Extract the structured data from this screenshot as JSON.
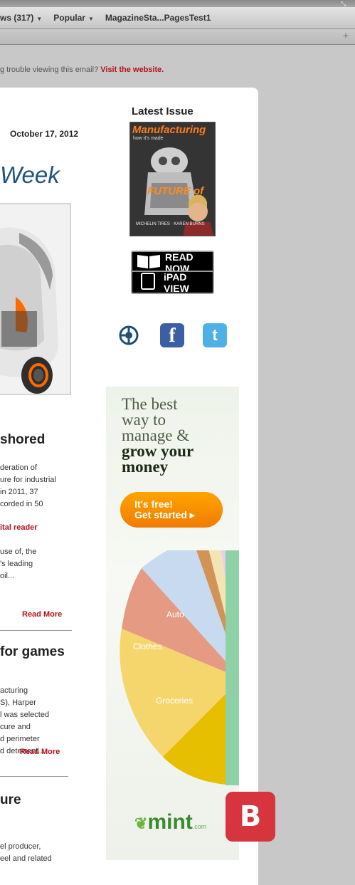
{
  "browser": {
    "bookmarks": [
      {
        "label": "ws (317)",
        "has_menu": true
      },
      {
        "label": "Popular",
        "has_menu": true
      },
      {
        "label": "MagazineSta...PagesTest1",
        "has_menu": false
      }
    ],
    "caret": "▼",
    "new_tab": "+"
  },
  "email": {
    "trouble_text": "g trouble viewing this email?",
    "trouble_link": "Visit the website.",
    "date": "October 17, 2012",
    "masthead_word": "Week",
    "articles": [
      {
        "headline": "shored",
        "lines": [
          "deration of",
          "ure for industrial",
          " in 2011, 37",
          "corded in 50"
        ],
        "related": "ital reader",
        "lines2": [
          "use of, the",
          "'s leading",
          "oil..."
        ],
        "read_more": "Read More"
      },
      {
        "headline": " for games",
        "lines": [
          "acturing",
          "S), Harper",
          "l was selected",
          "cure and",
          "d perimeter",
          "d deterrent..."
        ],
        "read_more": "Read More"
      },
      {
        "headline": "ure",
        "lines": [
          "el producer,",
          "eel and related"
        ]
      }
    ],
    "sidebar": {
      "latest_issue_title": "Latest Issue",
      "cover": {
        "brand": "Manufacturing",
        "tagline": "how it's made",
        "feature": "FUTURE of",
        "names": "MICHELIN TIRES · KAREN BURNS"
      },
      "read_now": "READ NOW",
      "ipad_view": "iPAD VIEW",
      "social_icons": [
        "rss-icon",
        "facebook-icon",
        "twitter-icon"
      ]
    },
    "ad": {
      "headline_lines": [
        "The best",
        "way to",
        "manage &",
        "grow your",
        "money"
      ],
      "cta_line1": "It's free!",
      "cta_line2": "Get started ▸",
      "pie_labels": [
        "Auto",
        "Clothes",
        "Groceries"
      ],
      "brand": "mint",
      "brand_suffix": ".com"
    },
    "badge": "B"
  },
  "colors": {
    "accent_red": "#b1121a",
    "title_blue": "#1d5480",
    "ad_orange": "#f08a00",
    "mint_green": "#3a8a2f",
    "badge_red": "#d7353d"
  }
}
